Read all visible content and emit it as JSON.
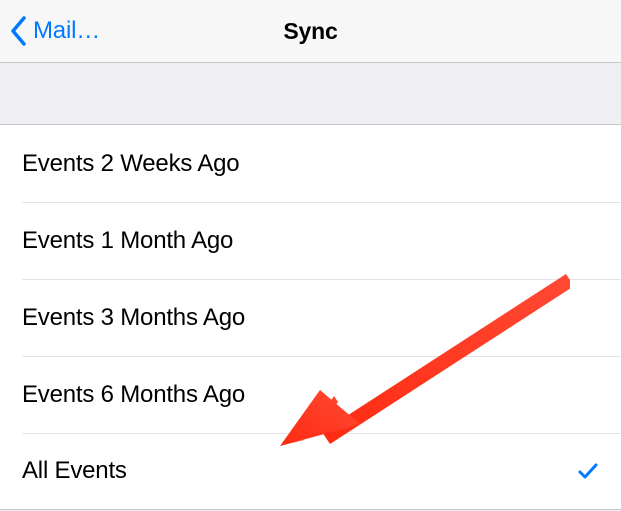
{
  "nav": {
    "back_label": "Mail…",
    "title": "Sync"
  },
  "options": [
    {
      "label": "Events 2 Weeks Ago",
      "selected": false
    },
    {
      "label": "Events 1 Month Ago",
      "selected": false
    },
    {
      "label": "Events 3 Months Ago",
      "selected": false
    },
    {
      "label": "Events 6 Months Ago",
      "selected": false
    },
    {
      "label": "All Events",
      "selected": true
    }
  ],
  "annotation": {
    "arrow_color": "#ff3320"
  }
}
